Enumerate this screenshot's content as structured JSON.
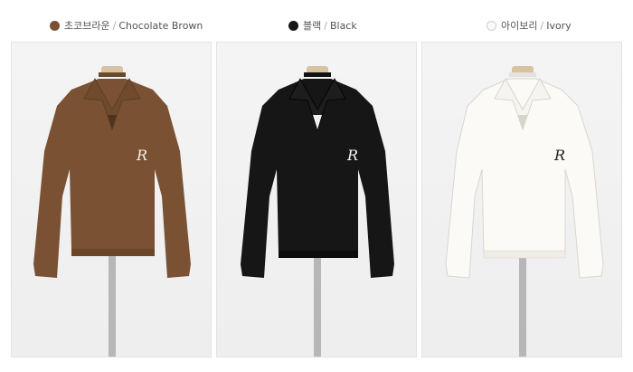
{
  "variants": [
    {
      "name_ko": "초코브라운",
      "name_en": "Chocolate Brown",
      "color": "#7a5233",
      "icon": "brown-color-swatch-icon"
    },
    {
      "name_ko": "블랙",
      "name_en": "Black",
      "color": "#161616",
      "icon": "black-color-swatch-icon"
    },
    {
      "name_ko": "아이보리",
      "name_en": "Ivory",
      "color": "#fbfaf6",
      "icon": "ivory-color-swatch-icon"
    }
  ],
  "separator": "/",
  "stand_color": "#b7b7b7",
  "cap_color": "#d8c3a0"
}
